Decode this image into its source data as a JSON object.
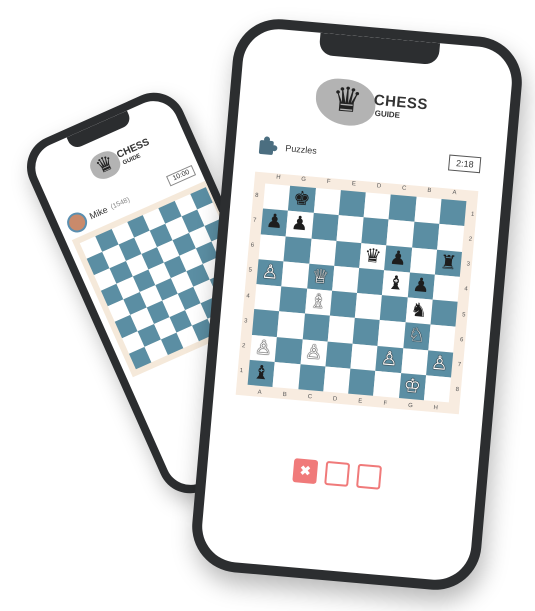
{
  "back_phone": {
    "logo_title": "CHESS",
    "logo_sub": "GUIDE",
    "player_name": "Mike",
    "player_rating": "(1548)",
    "timer": "10:00"
  },
  "front_phone": {
    "logo_title": "CHESS",
    "logo_sub": "GUIDE",
    "icon": "puzzle-icon",
    "section_label": "Puzzles",
    "timer": "2:18",
    "files": [
      "H",
      "G",
      "F",
      "E",
      "D",
      "C",
      "B",
      "A"
    ],
    "files_bottom": [
      "A",
      "B",
      "C",
      "D",
      "E",
      "F",
      "G",
      "H"
    ],
    "ranks_left": [
      "8",
      "7",
      "6",
      "5",
      "4",
      "3",
      "2",
      "1"
    ],
    "ranks_right": [
      "1",
      "2",
      "3",
      "4",
      "5",
      "6",
      "7",
      "8"
    ],
    "board": [
      [
        "",
        "♚",
        "",
        "",
        "",
        "",
        "",
        ""
      ],
      [
        "♟",
        "♟",
        "",
        "",
        "",
        "",
        "",
        ""
      ],
      [
        "",
        "",
        "",
        "",
        "♛",
        "♟",
        "",
        "♜"
      ],
      [
        "♙",
        "",
        "♕",
        "",
        "",
        "♝",
        "♟",
        ""
      ],
      [
        "",
        "",
        "♗",
        "",
        "",
        "",
        "♞",
        ""
      ],
      [
        "",
        "",
        "",
        "",
        "",
        "",
        "♘",
        ""
      ],
      [
        "♙",
        "",
        "♙",
        "",
        "",
        "♙",
        "",
        "♙"
      ],
      [
        "♝",
        "",
        "",
        "",
        "",
        "",
        "♔",
        ""
      ]
    ],
    "answers": [
      {
        "state": "wrong",
        "symbol": "✖"
      },
      {
        "state": "empty",
        "symbol": ""
      },
      {
        "state": "empty",
        "symbol": ""
      }
    ],
    "colors": {
      "dark_square": "#5b8ea3",
      "light_square": "#ffffff",
      "accent_red": "#f07a7a"
    }
  }
}
